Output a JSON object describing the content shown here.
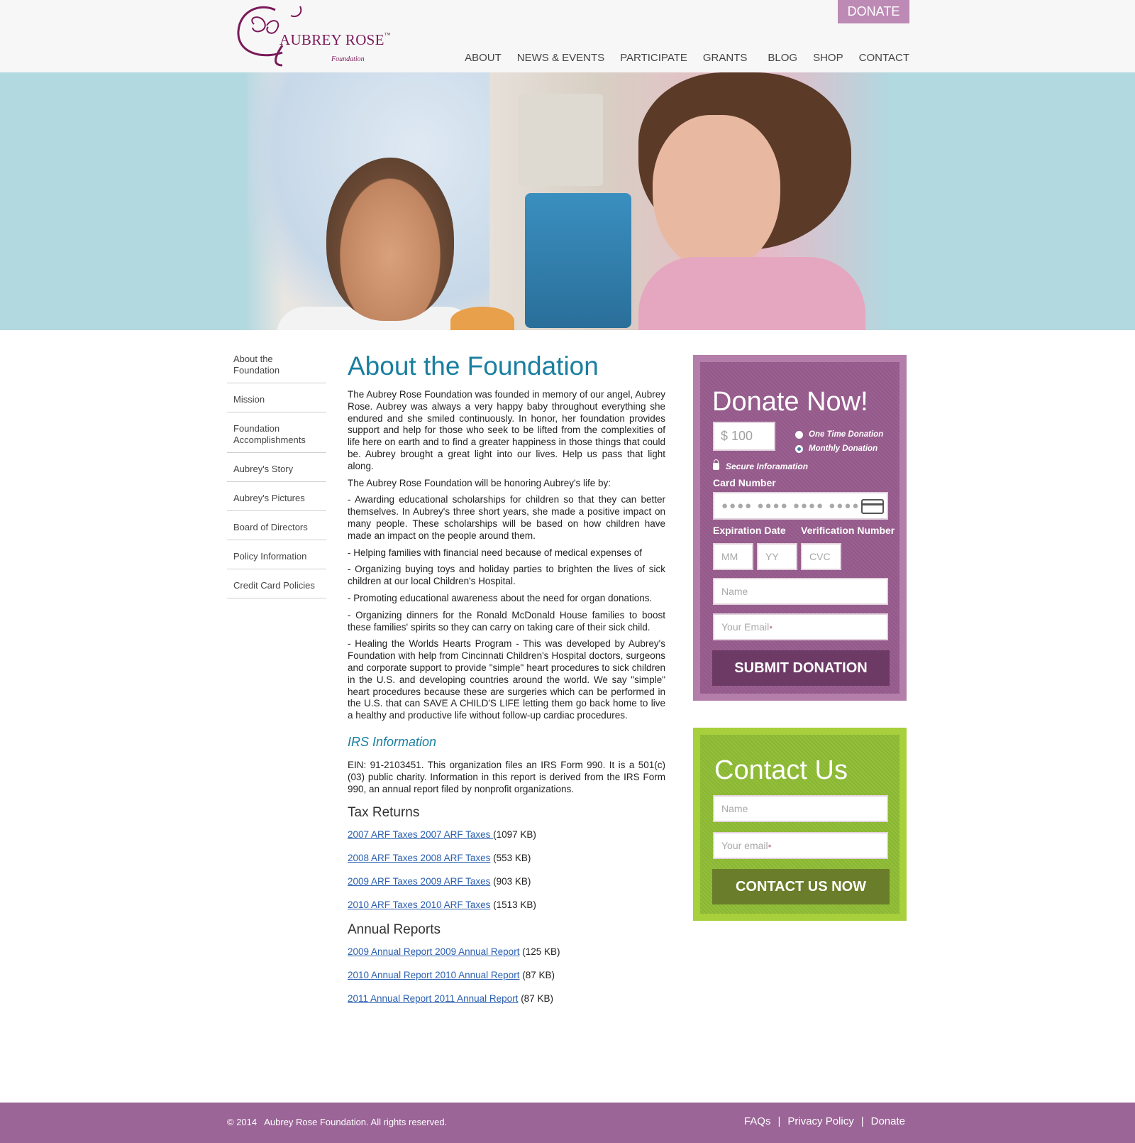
{
  "header": {
    "logo_text": "AUBREY ROSE",
    "logo_sub": "Foundation",
    "donate_label": "DONATE",
    "nav": [
      "ABOUT",
      "NEWS & EVENTS",
      "PARTICIPATE",
      "GRANTS",
      "BLOG",
      "SHOP",
      "CONTACT"
    ]
  },
  "sidebar": {
    "items": [
      "About the Foundation",
      "Mission",
      "Foundation Accomplishments",
      "Aubrey's Story",
      "Aubrey's Pictures",
      "Board of Directors",
      "Policy Information",
      "Credit Card Policies"
    ]
  },
  "main": {
    "title": "About the Foundation",
    "paragraphs": [
      "The Aubrey Rose Foundation was founded in memory of our angel, Aubrey Rose. Aubrey was always a very happy baby throughout everything she endured and she smiled continuously. In honor, her foundation provides support and help for those who seek to be lifted from the complexities of life here on earth and to find a greater happiness in those things that could be. Aubrey brought a great light into our lives. Help us pass that light along.",
      "The Aubrey Rose Foundation will be honoring Aubrey's life by:",
      "- Awarding educational scholarships for children so that they can better themselves. In Aubrey's three short years, she made a positive impact on many people. These scholarships will be based on how children have made an impact on the people around them.",
      "- Helping families with financial need because of medical expenses of",
      "- Organizing buying toys and holiday parties to brighten the lives of sick children at our local Children's Hospital.",
      "- Promoting educational awareness about the need for organ donations.",
      "- Organizing dinners for the Ronald McDonald House families to boost these families' spirits so they can carry on taking care of their sick child.",
      "- Healing the Worlds Hearts Program - This was developed by Aubrey's Foundation with help from Cincinnati Children's Hospital doctors, surgeons and corporate support to provide \"simple\" heart procedures to sick children in the U.S. and developing countries around the world. We say \"simple\" heart procedures because these are surgeries which can be performed in the U.S. that can SAVE A CHILD'S LIFE letting them go back home to live a healthy and productive life without follow-up cardiac procedures."
    ],
    "irs_heading": "IRS Information",
    "irs_text": "EIN: 91-2103451. This organization files an IRS Form 990. It is a 501(c)(03) public charity. Information in this report is derived from the IRS Form 990, an annual report filed by nonprofit organizations.",
    "tax_heading": "Tax Returns",
    "tax_files": [
      {
        "link": "2007 ARF Taxes 2007 ARF Taxes ",
        "size": "(1097 KB)"
      },
      {
        "link": "2008 ARF Taxes 2008 ARF Taxes",
        "size": " (553 KB)"
      },
      {
        "link": "2009 ARF Taxes 2009 ARF Taxes",
        "size": " (903 KB)"
      },
      {
        "link": "2010 ARF Taxes 2010 ARF Taxes",
        "size": " (1513 KB)"
      }
    ],
    "annual_heading": "Annual Reports",
    "annual_files": [
      {
        "link": "2009 Annual Report 2009 Annual Report",
        "size": " (125 KB)"
      },
      {
        "link": "2010 Annual Report 2010 Annual Report",
        "size": " (87 KB)"
      },
      {
        "link": "2011 Annual Report 2011 Annual Report",
        "size": " (87 KB) "
      }
    ]
  },
  "donate": {
    "title": "Donate Now!",
    "amount": "$ 100",
    "one_time": "One Time Donation",
    "monthly": "Monthly Donation",
    "selected_frequency": "Monthly Donation",
    "secure": "Secure Inforamation",
    "card_label": "Card Number",
    "card_placeholder": "●●●● ●●●● ●●●● ●●●●",
    "exp_label": "Expiration Date",
    "cvc_label": "Verification Number",
    "mm": "MM",
    "yy": "YY",
    "cvc": "CVC",
    "name_placeholder": "Name",
    "email_placeholder": "Your Email",
    "submit": "SUBMIT DONATION"
  },
  "contact": {
    "title": "Contact Us",
    "name_placeholder": "Name",
    "email_placeholder": "Your email",
    "button": "CONTACT US NOW"
  },
  "footer": {
    "copyright": "© 2014   Aubrey Rose Foundation. All rights reserved.",
    "links": [
      "FAQs",
      "Privacy Policy",
      "Donate"
    ]
  },
  "colors": {
    "brand_purple": "#9b6597",
    "donate_purple": "#b37ea9",
    "title_blue": "#1a7fa0",
    "contact_green": "#a8cf3c",
    "link_blue": "#2a5fb0"
  }
}
